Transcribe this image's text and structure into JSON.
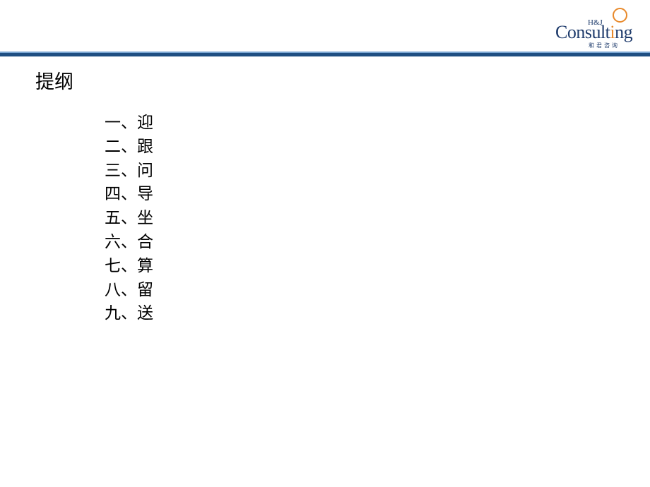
{
  "logo": {
    "top_text": "H&J",
    "word_before": "Consult",
    "word_accent": "i",
    "word_after": "ng",
    "chinese_name": "和君咨询",
    "colors": {
      "brand_navy": "#1d3a6b",
      "brand_orange": "#e8892a"
    }
  },
  "header": {
    "rule_colors": {
      "light": "#7aa6d2",
      "dark": "#1f4f82"
    }
  },
  "slide": {
    "title": "提纲",
    "outline": [
      {
        "number": "一、",
        "text": "迎"
      },
      {
        "number": "二、",
        "text": "跟"
      },
      {
        "number": "三、",
        "text": "问"
      },
      {
        "number": "四、",
        "text": "导"
      },
      {
        "number": "五、",
        "text": "坐"
      },
      {
        "number": "六、",
        "text": "合"
      },
      {
        "number": "七、",
        "text": "算"
      },
      {
        "number": "八、",
        "text": "留"
      },
      {
        "number": "九、",
        "text": "送"
      }
    ]
  }
}
